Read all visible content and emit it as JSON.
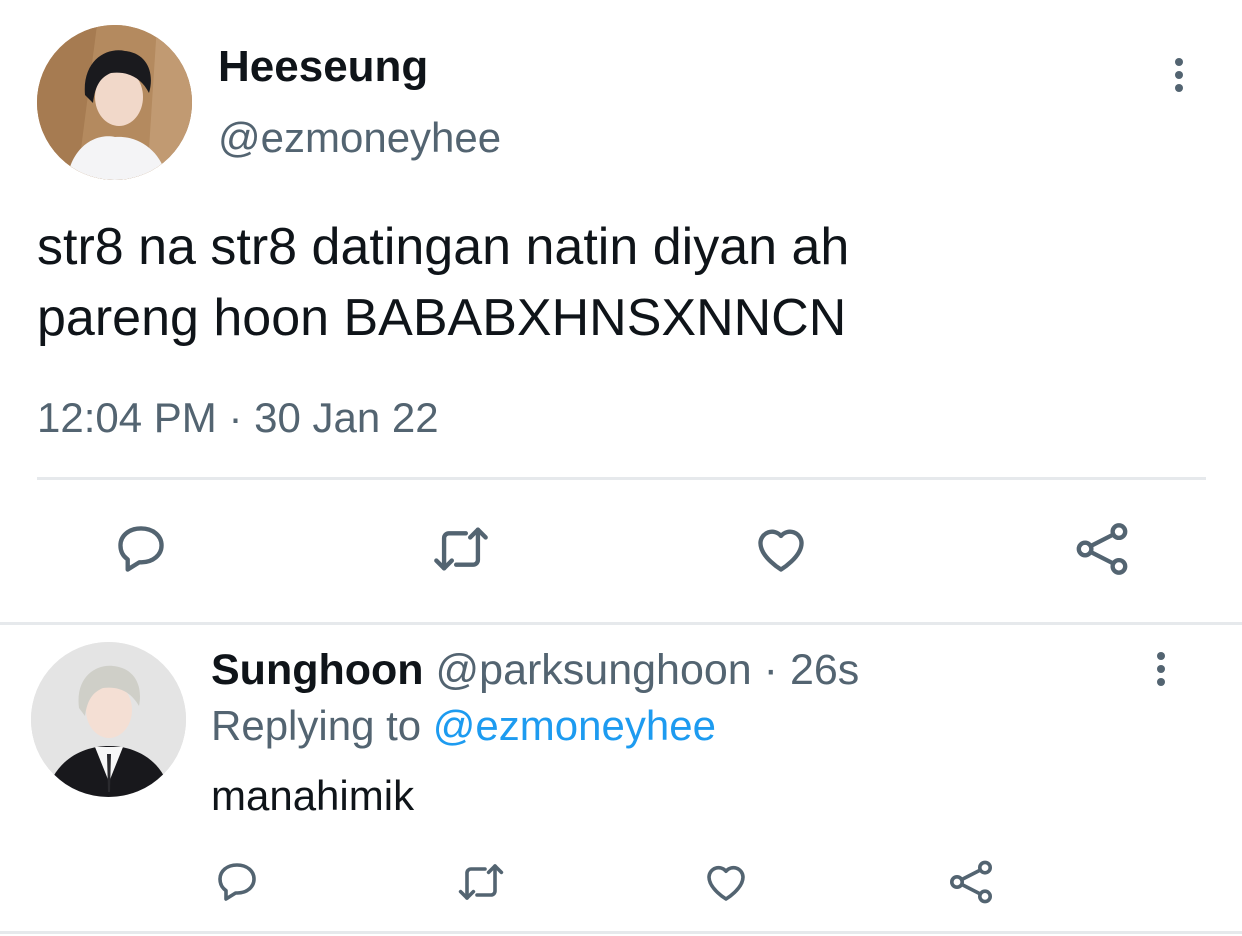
{
  "main_tweet": {
    "author_name": "Heeseung",
    "author_handle": "@ezmoneyhee",
    "text_line1": "str8 na str8 datingan natin diyan ah",
    "text_line2": "pareng hoon BABABXHNSXNNCN",
    "timestamp": "12:04 PM · 30 Jan 22"
  },
  "reply_tweet": {
    "author_name": "Sunghoon",
    "author_handle": "@parksunghoon",
    "separator": "·",
    "age": "26s",
    "replying_prefix": "Replying to",
    "replying_handle": "@ezmoneyhee",
    "text": "manahimik"
  },
  "icons": {
    "reply": "reply-icon",
    "retweet": "retweet-icon",
    "like": "like-icon",
    "share": "share-icon",
    "more": "more-icon"
  },
  "colors": {
    "text": "#0f1419",
    "muted": "#536471",
    "link": "#1d9bf0",
    "divider": "#e6e9ec"
  }
}
